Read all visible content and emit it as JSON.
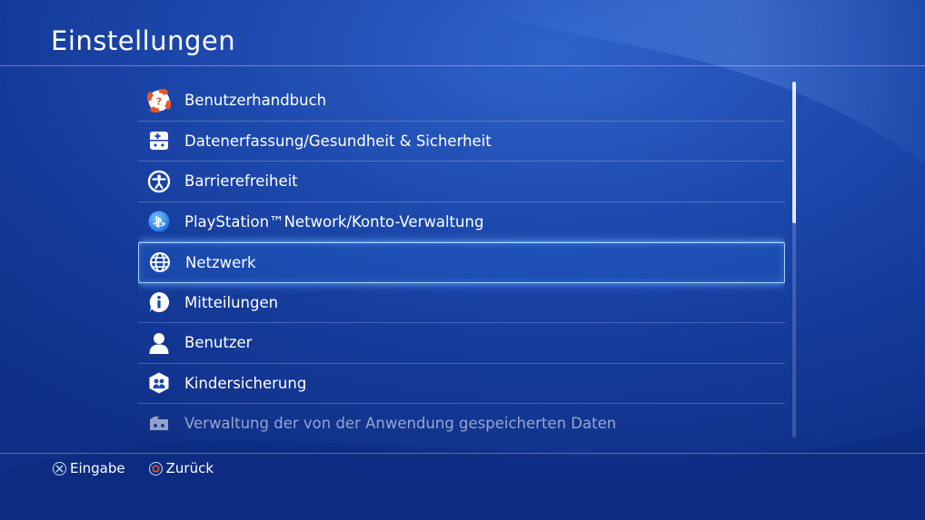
{
  "header": {
    "title": "Einstellungen"
  },
  "menu": {
    "items": [
      {
        "label": "Benutzerhandbuch",
        "icon": "help-lifebuoy-icon"
      },
      {
        "label": "Datenerfassung/Gesundheit & Sicherheit",
        "icon": "health-safety-icon"
      },
      {
        "label": "Barrierefreiheit",
        "icon": "accessibility-icon"
      },
      {
        "label": "PlayStation™Network/Konto-Verwaltung",
        "icon": "playstation-network-icon"
      },
      {
        "label": "Netzwerk",
        "icon": "globe-icon"
      },
      {
        "label": "Mitteilungen",
        "icon": "info-icon"
      },
      {
        "label": "Benutzer",
        "icon": "user-icon"
      },
      {
        "label": "Kindersicherung",
        "icon": "parental-control-icon"
      },
      {
        "label": "Verwaltung der von der Anwendung gespeicherten Daten",
        "icon": "saved-data-icon"
      }
    ],
    "selected_label": "Netzwerk"
  },
  "footer": {
    "enter_label": "Eingabe",
    "back_label": "Zurück"
  },
  "colors": {
    "accent": "#9fd0ff",
    "background": "#1d49ad",
    "lifebuoy": "#e8562b"
  }
}
